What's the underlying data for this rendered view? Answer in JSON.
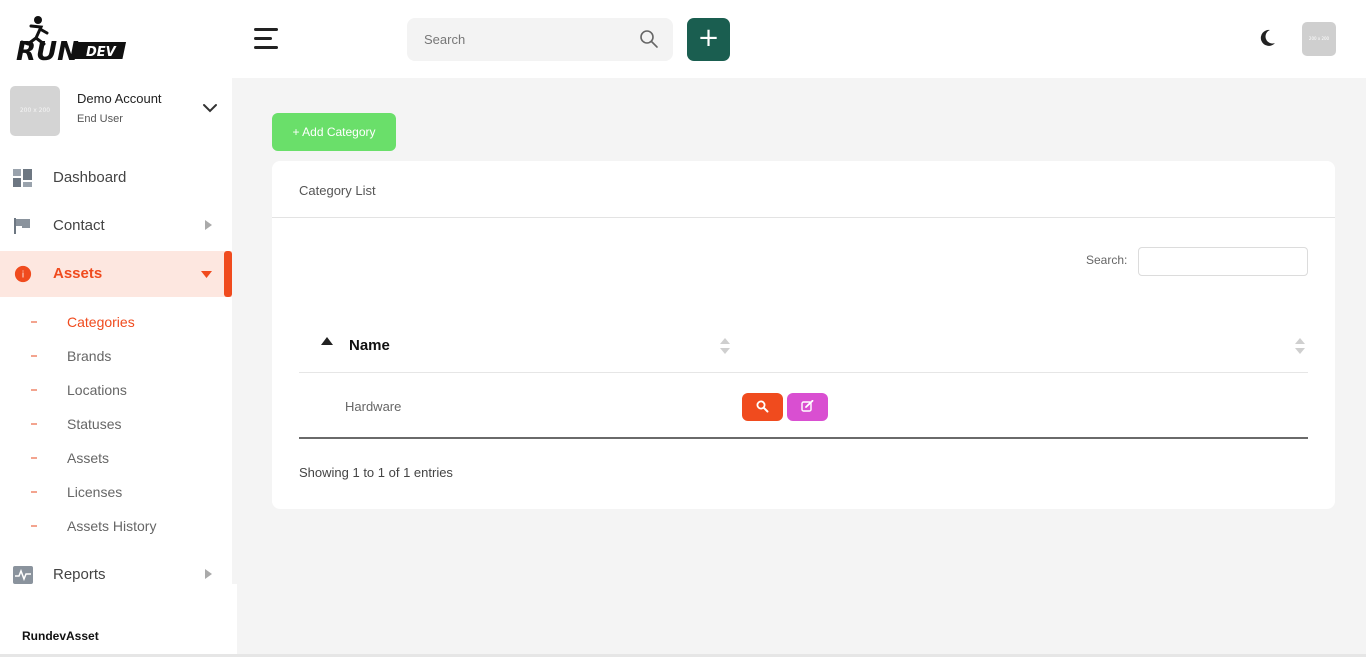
{
  "topbar": {
    "search_placeholder": "Search",
    "add_label": "+",
    "avatar_text": "200 x 200"
  },
  "account": {
    "avatar_text": "200 x 200",
    "name": "Demo Account",
    "role": "End User"
  },
  "sidebar": {
    "items": [
      {
        "label": "Dashboard",
        "icon": "dashboard-icon"
      },
      {
        "label": "Contact",
        "icon": "flag-icon"
      },
      {
        "label": "Assets",
        "icon": "info-circle-icon",
        "badge": "i"
      },
      {
        "label": "Reports",
        "icon": "activity-icon"
      }
    ],
    "subitems": [
      {
        "label": "Categories"
      },
      {
        "label": "Brands"
      },
      {
        "label": "Locations"
      },
      {
        "label": "Statuses"
      },
      {
        "label": "Assets"
      },
      {
        "label": "Licenses"
      },
      {
        "label": "Assets History"
      }
    ],
    "footer_brand": "RundevAsset"
  },
  "main": {
    "add_button": "+ Add Category",
    "card_title": "Category List",
    "search_label": "Search:",
    "table": {
      "columns": [
        "Name",
        ""
      ],
      "rows": [
        {
          "name": "Hardware"
        }
      ]
    },
    "info": "Showing 1 to 1 of 1 entries"
  },
  "colors": {
    "accent": "#f04b1e",
    "add_button": "#6adf6a",
    "plus_button": "#1a5e50",
    "edit_button": "#d94fd1"
  }
}
